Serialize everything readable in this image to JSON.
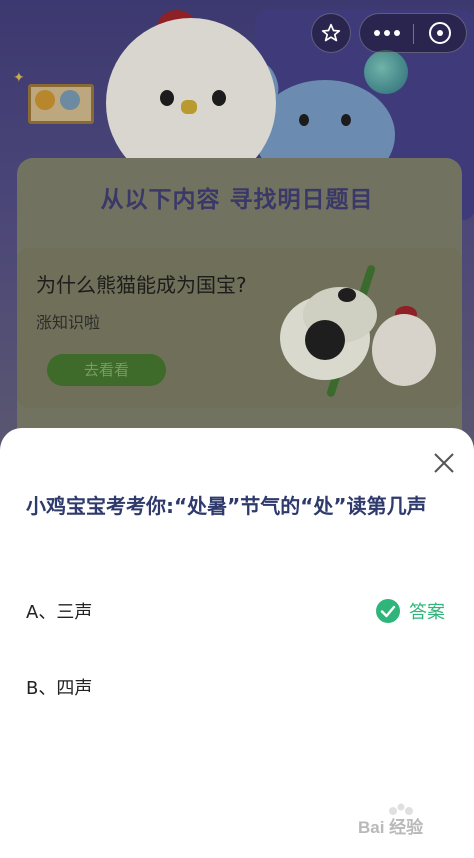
{
  "background": {
    "card_title": "从以下内容 寻找明日题目",
    "article_title": "为什么熊猫能成为国宝?",
    "article_subtitle": "涨知识啦",
    "go_button": "去看看"
  },
  "capsule": {
    "favorite_icon": "star-icon",
    "more_icon": "more-dots-icon",
    "close_icon": "close-circle-icon"
  },
  "sheet": {
    "question": "小鸡宝宝考考你:“处暑”节气的“处”读第几声",
    "options": [
      {
        "label": "A、三声"
      },
      {
        "label": "B、四声"
      }
    ],
    "answer_label": "答案",
    "answer_color": "#2fb57a",
    "close_icon": "close-icon"
  },
  "watermark": {
    "text": "Bai 经验"
  }
}
